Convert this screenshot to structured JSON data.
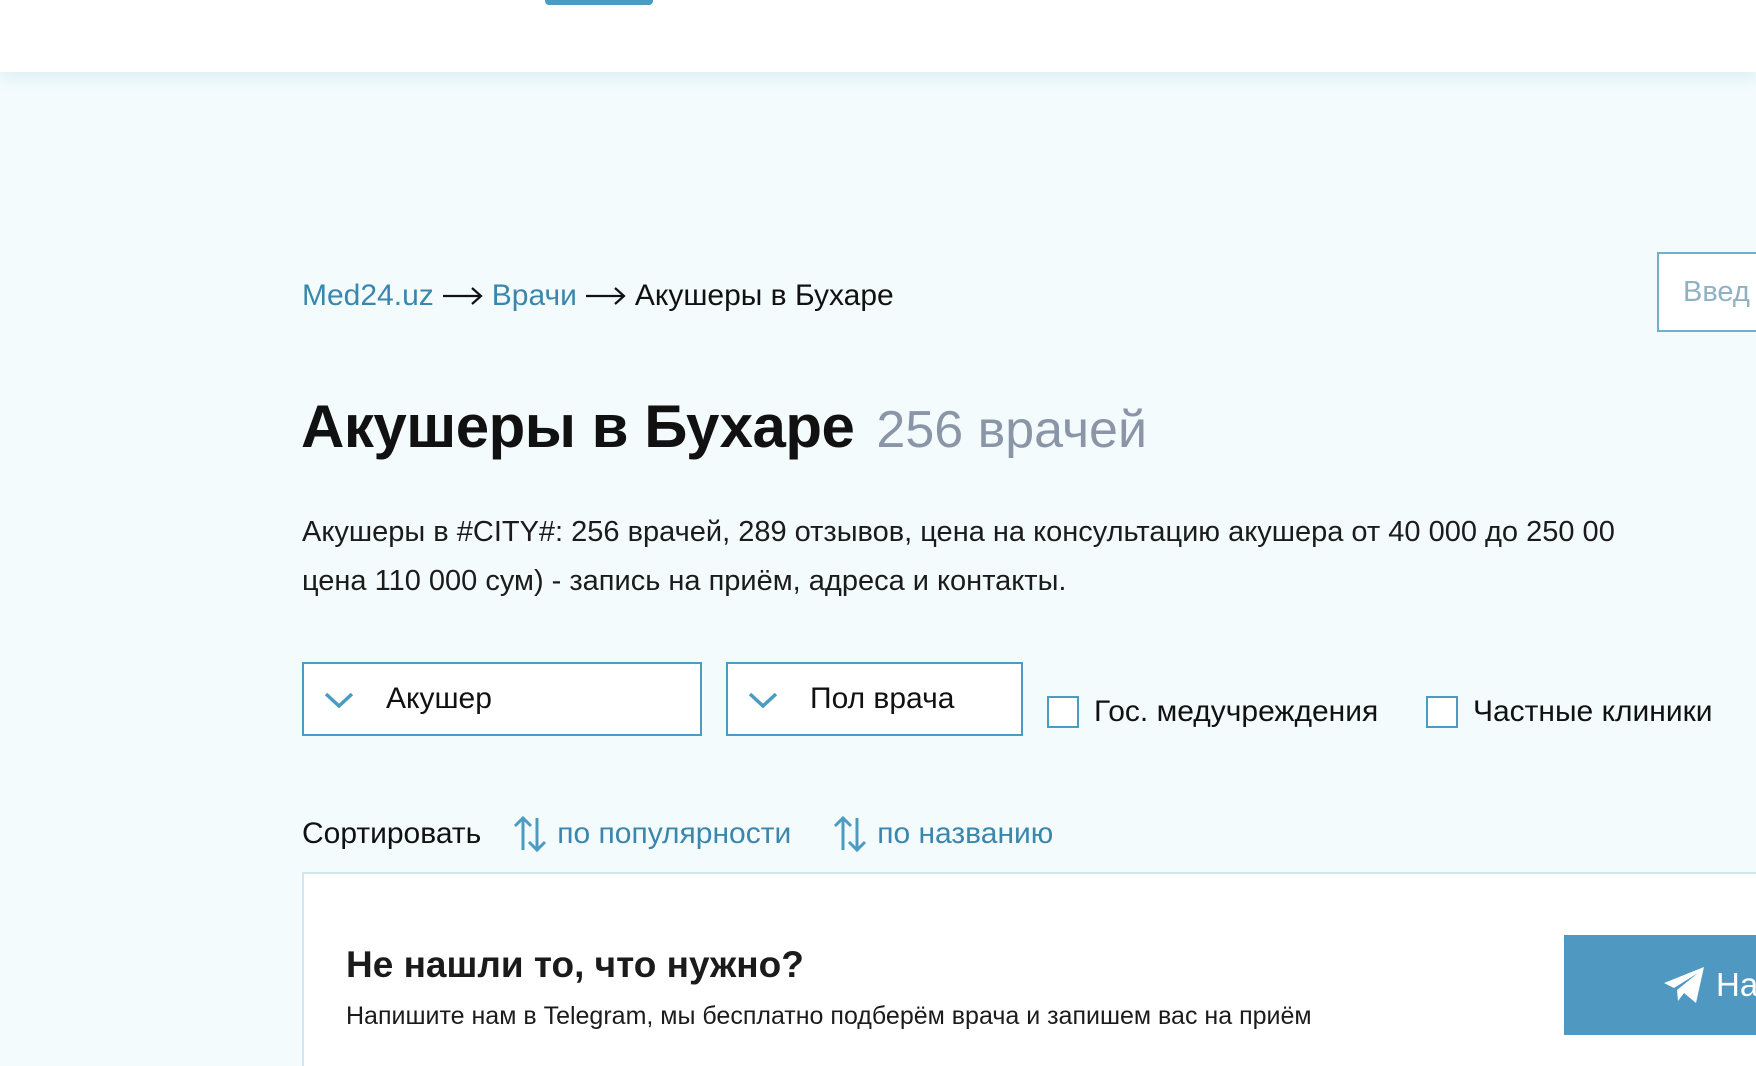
{
  "breadcrumb": {
    "home": "Med24.uz",
    "doctors": "Врачи",
    "current": "Акушеры в Бухаре"
  },
  "search": {
    "placeholder": "Введ"
  },
  "title": {
    "main": "Акушеры в Бухаре",
    "count": "256 врачей"
  },
  "description": {
    "line1": "Акушеры в #CITY#: 256 врачей, 289 отзывов, цена на консультацию акушера от 40 000 до 250 00",
    "line2": "цена 110 000 сум) - запись на приём, адреса и контакты."
  },
  "filters": {
    "specialty": "Акушер",
    "gender": "Пол врача",
    "gov_clinics": "Гос. медучреждения",
    "private_clinics": "Частные клиники"
  },
  "sort": {
    "label": "Сортировать",
    "by_popularity": "по популярности",
    "by_name": "по названию"
  },
  "promo": {
    "title": "Не нашли то, что нужно?",
    "text": "Напишите нам в Telegram, мы бесплатно подберём врача и запишем вас на приём",
    "button": "На"
  },
  "colors": {
    "accent": "#4a9cc3",
    "link": "#3a86ad",
    "background": "#f3fbfd",
    "count_gray": "#8a96a8"
  },
  "icons": {
    "arrow": "arrow-right-icon",
    "chevron": "chevron-down-icon",
    "sort": "sort-arrows-icon",
    "telegram": "telegram-plane-icon"
  }
}
